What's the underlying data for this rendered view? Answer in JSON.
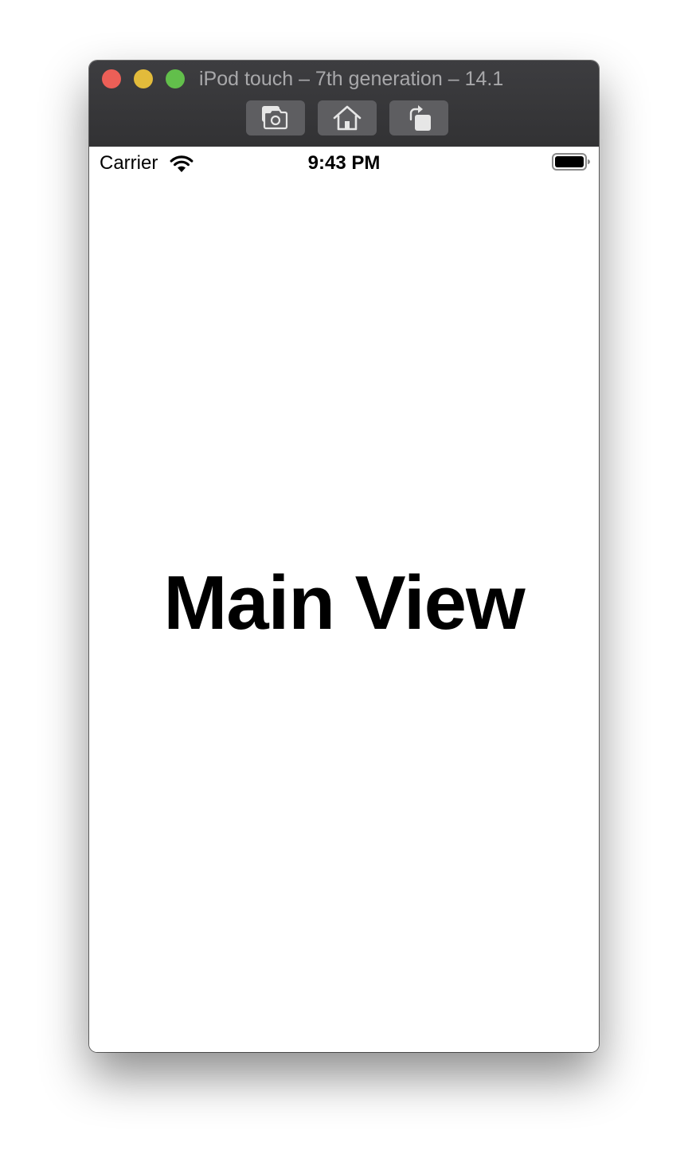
{
  "window": {
    "title": "iPod touch – 7th generation – 14.1",
    "traffic_lights": [
      "close",
      "minimize",
      "zoom"
    ],
    "toolbar": [
      {
        "name": "screenshot",
        "icon": "camera-icon"
      },
      {
        "name": "home",
        "icon": "home-icon"
      },
      {
        "name": "rotate",
        "icon": "rotate-icon"
      }
    ]
  },
  "status_bar": {
    "carrier": "Carrier",
    "time": "9:43 PM",
    "wifi_icon": "wifi-icon",
    "battery_icon": "battery-icon",
    "battery_level": 1.0
  },
  "main": {
    "label": "Main View"
  },
  "colors": {
    "titlebar": "#323234",
    "close": "#ec5f57",
    "minimize": "#e2bb3b",
    "zoom": "#62bf4b",
    "tool_button": "#5e5e61",
    "screen_background": "#ffffff",
    "text": "#000000"
  }
}
